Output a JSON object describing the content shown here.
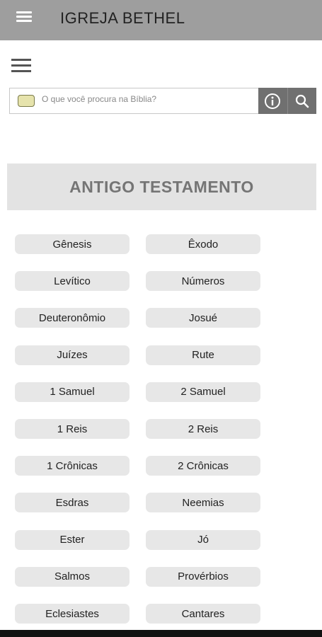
{
  "appbar": {
    "title": "IGREJA BETHEL"
  },
  "search": {
    "placeholder": "O que você procura na Bíblia?",
    "book_icon": "book-icon",
    "info_icon": "info-icon",
    "search_icon": "search-icon"
  },
  "section": {
    "title": "ANTIGO TESTAMENTO"
  },
  "books": [
    "Gênesis",
    "Êxodo",
    "Levítico",
    "Números",
    "Deuteronômio",
    "Josué",
    "Juízes",
    "Rute",
    "1 Samuel",
    "2 Samuel",
    "1 Reis",
    "2 Reis",
    "1 Crônicas",
    "2 Crônicas",
    "Esdras",
    "Neemias",
    "Ester",
    "Jó",
    "Salmos",
    "Provérbios",
    "Eclesiastes",
    "Cantares"
  ],
  "colors": {
    "appbar": "#9e9e9e",
    "button": "#e7e7e7",
    "header": "#e3e3e3",
    "search_buttons": "#707070"
  }
}
